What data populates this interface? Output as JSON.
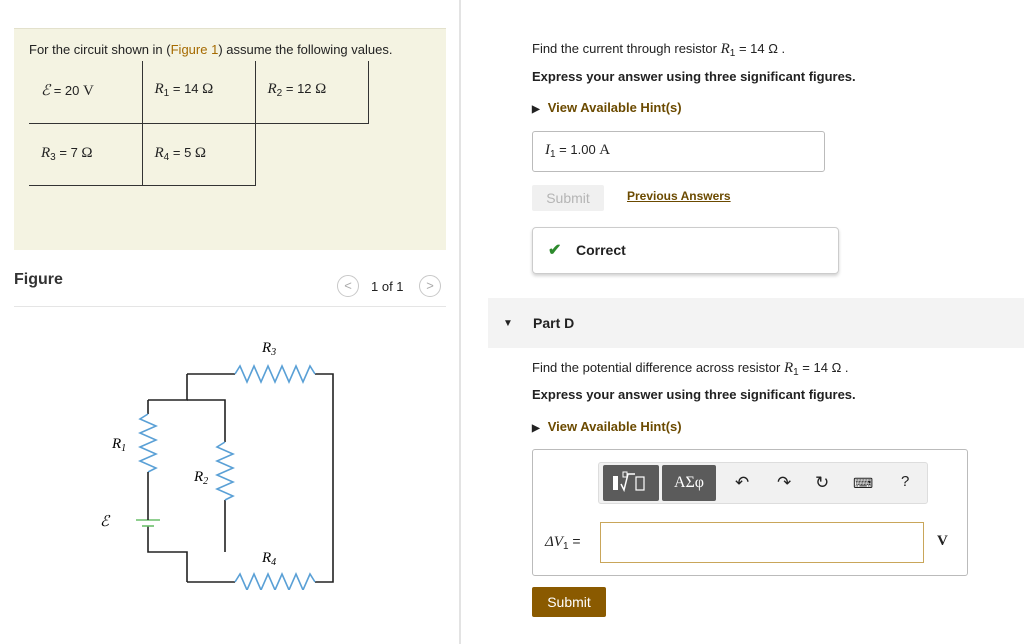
{
  "problem": {
    "intro_prefix": "For the circuit shown in (",
    "intro_link": "Figure 1",
    "intro_suffix": ") assume the following values.",
    "values": [
      {
        "symbol": "ℰ",
        "sub": "",
        "value": "20",
        "unit": "V"
      },
      {
        "symbol": "R",
        "sub": "1",
        "value": "14",
        "unit": "Ω"
      },
      {
        "symbol": "R",
        "sub": "2",
        "value": "12",
        "unit": "Ω"
      },
      {
        "symbol": "R",
        "sub": "3",
        "value": "7",
        "unit": "Ω"
      },
      {
        "symbol": "R",
        "sub": "4",
        "value": "5",
        "unit": "Ω"
      }
    ]
  },
  "figure": {
    "title": "Figure",
    "pager": "1 of 1",
    "prev_icon": "chevron-left-icon",
    "next_icon": "chevron-right-icon",
    "labels": {
      "r1": "R",
      "r1_sub": "1",
      "r2": "R",
      "r2_sub": "2",
      "r3": "R",
      "r3_sub": "3",
      "r4": "R",
      "r4_sub": "4",
      "emf": "ℰ"
    }
  },
  "part_c": {
    "question_prefix": "Find the current through resistor ",
    "question_sym": "R",
    "question_sub": "1",
    "question_value": " = 14 Ω .",
    "instruction": "Express your answer using three significant figures.",
    "hint_label": "View Available Hint(s)",
    "answer_sym": "I",
    "answer_sub": "1",
    "answer_eq": " =  1.00 ",
    "answer_unit": "A",
    "submit_label": "Submit",
    "previous_answers": "Previous Answers",
    "feedback": "Correct"
  },
  "part_d": {
    "label": "Part D",
    "question_prefix": "Find the potential difference across resistor ",
    "question_sym": "R",
    "question_sub": "1",
    "question_value": " = 14 Ω .",
    "instruction": "Express your answer using three significant figures.",
    "hint_label": "View Available Hint(s)",
    "input_label": "ΔV",
    "input_sub": "1",
    "input_eq": " =",
    "input_value": "",
    "unit": "V",
    "toolbar": {
      "templates_icon": "math-templates-icon",
      "greek": "ΑΣφ",
      "undo_icon": "undo-icon",
      "redo_icon": "redo-icon",
      "reset_icon": "reset-icon",
      "keyboard_icon": "keyboard-icon",
      "help": "?"
    },
    "submit_label": "Submit"
  },
  "colors": {
    "accent": "#8a5a00",
    "link": "#a56a00",
    "correct": "#2d8a2d",
    "panel": "#f4f3e2",
    "circuit": "#5aa0d6",
    "battery": "#6cbf6c"
  }
}
